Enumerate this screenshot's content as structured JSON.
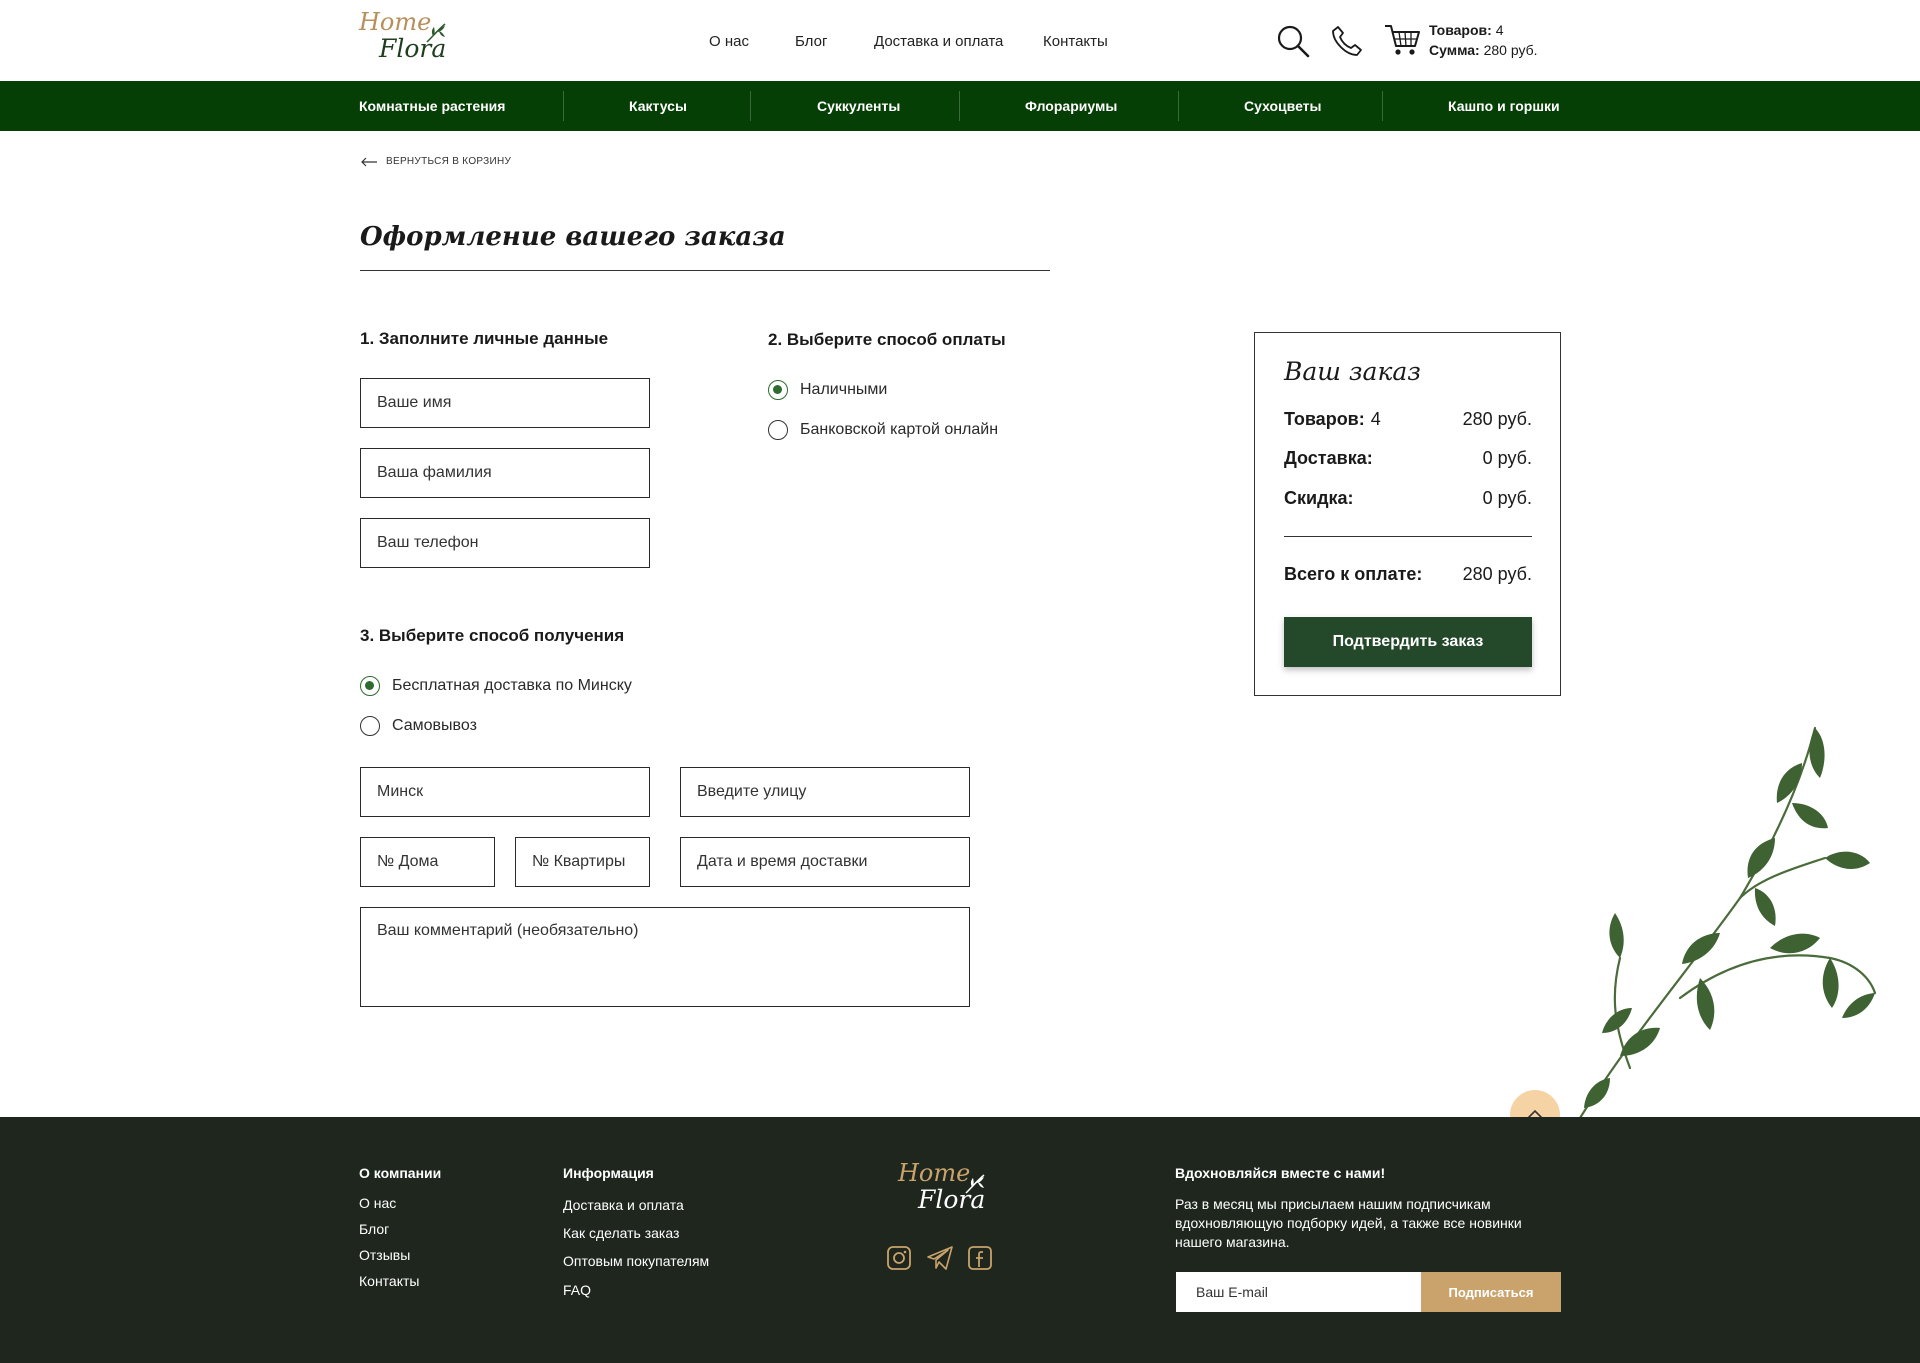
{
  "brand": {
    "home": "Home",
    "flora": "Flora"
  },
  "topnav": [
    "О нас",
    "Блог",
    "Доставка и оплата",
    "Контакты"
  ],
  "cart": {
    "items_label": "Товаров:",
    "items_value": "4",
    "sum_label": "Сумма:",
    "sum_value": "280 руб."
  },
  "categories": [
    "Комнатные растения",
    "Кактусы",
    "Суккуленты",
    "Флорариумы",
    "Сухоцветы",
    "Кашпо и горшки"
  ],
  "back_link": "ВЕРНУТЬСЯ В КОРЗИНУ",
  "page_title": "Оформление вашего заказа",
  "personal": {
    "heading": "1. Заполните личные данные",
    "name": "Ваше имя",
    "surname": "Ваша фамилия",
    "phone": "Ваш телефон"
  },
  "payment": {
    "heading": "2. Выберите способ оплаты",
    "options": [
      "Наличными",
      "Банковской картой онлайн"
    ],
    "selected": 0
  },
  "delivery": {
    "heading": "3. Выберите способ получения",
    "options": [
      "Бесплатная доставка по Минску",
      "Самовывоз"
    ],
    "selected": 0,
    "city": "Минск",
    "street": "Введите улицу",
    "house": "№ Дома",
    "apartment": "№ Квартиры",
    "datetime": "Дата и время доставки",
    "comment": "Ваш комментарий (необязательно)"
  },
  "summary": {
    "title": "Ваш заказ",
    "items_label": "Товаров:",
    "items_count": "4",
    "items_value": "280 руб.",
    "delivery_label": "Доставка:",
    "delivery_value": "0 руб.",
    "discount_label": "Скидка:",
    "discount_value": "0 руб.",
    "total_label": "Всего к оплате:",
    "total_value": "280 руб.",
    "confirm": "Подтвердить заказ"
  },
  "footer": {
    "company_heading": "О компании",
    "company_links": [
      "О нас",
      "Блог",
      "Отзывы",
      "Контакты"
    ],
    "info_heading": "Информация",
    "info_links": [
      "Доставка и оплата",
      "Как сделать заказ",
      "Оптовым покупателям",
      "FAQ"
    ],
    "social_icons": [
      "instagram-icon",
      "telegram-icon",
      "facebook-icon"
    ],
    "subscribe_heading": "Вдохновляйся вместе с нами!",
    "subscribe_text": "Раз в месяц мы присылаем нашим подписчикам вдохновляющую подборку идей, а также  все новинки нашего магазина.",
    "email_placeholder": "Ваш E-mail",
    "subscribe_button": "Подписаться"
  },
  "colors": {
    "category_bar": "#063f06",
    "accent_green": "#24482a",
    "gold": "#c9a36b",
    "footer_bg": "#1e261e",
    "totop_bg": "#f6d3a4"
  }
}
